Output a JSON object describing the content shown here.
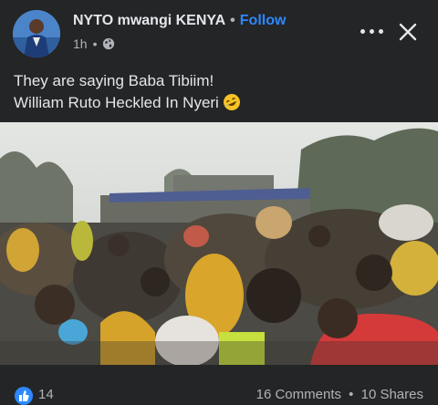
{
  "post": {
    "author": "NYTO mwangi KENYA",
    "separator": "•",
    "follow_label": "Follow",
    "timestamp": "1h",
    "meta_separator": "•",
    "caption_line1": "They are saying Baba Tibiim!",
    "caption_line2": "William Ruto Heckled In Nyeri",
    "caption_emoji": "rolling-on-floor-laughing-icon"
  },
  "footer": {
    "like_count": "14",
    "comments": "16 Comments",
    "separator": "•",
    "shares": "10 Shares"
  },
  "colors": {
    "background": "#242526",
    "text": "#e4e6eb",
    "secondary": "#b0b3b8",
    "accent": "#2d88ff"
  }
}
